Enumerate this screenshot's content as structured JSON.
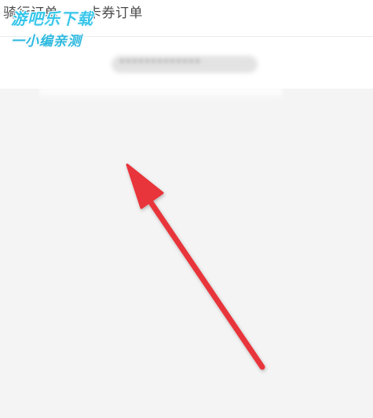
{
  "tabs": [
    {
      "label": "骑行订单"
    },
    {
      "label": "卡券订单"
    }
  ],
  "order_summary": {
    "blurred_text": "*************"
  },
  "watermark": {
    "line1": "游吧乐下载",
    "line2": "一小编亲测"
  },
  "colors": {
    "background": "#f4f4f4",
    "header": "#ffffff",
    "arrow": "#e8343a",
    "watermark": "#36c6ea"
  }
}
